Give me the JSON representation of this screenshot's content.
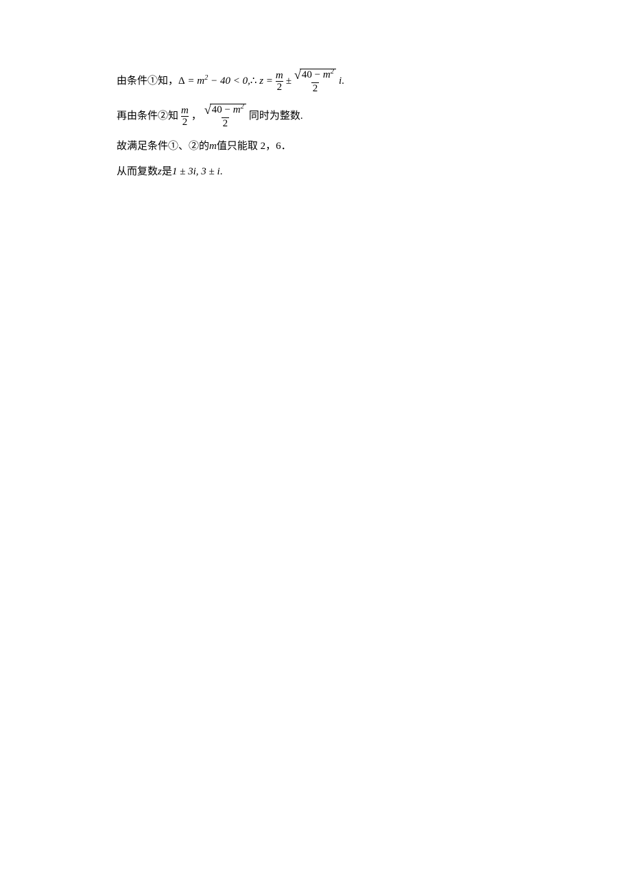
{
  "line1": {
    "t1": "由条件①知，",
    "delta": "Δ",
    "eq1_a": " = ",
    "m": "m",
    "sq": "2",
    "minus40": " − 40 < 0,",
    "therefore": "∴ ",
    "z": "z",
    "eq2": " = ",
    "frac1_num": "m",
    "frac1_den": "2",
    "pm": " ± ",
    "sqrt_inner_a": "40 − ",
    "sqrt_inner_m": "m",
    "sqrt_inner_sq": "2",
    "frac2_den": "2",
    "i": " i",
    "period": " ."
  },
  "line2": {
    "t1": "再由条件②知",
    "frac1_num": "m",
    "frac1_den": "2",
    "comma": " ，",
    "sqrt_inner_a": "40 − ",
    "sqrt_inner_m": "m",
    "sqrt_inner_sq": "2",
    "frac2_den": "2",
    "t2": " 同时为整数."
  },
  "line3": {
    "t1": "故满足条件①、②的",
    "m": "m",
    "t2": " 值只能取 2，6．"
  },
  "line4": {
    "t1": "从而复数",
    "z": "z",
    "t2": " 是",
    "expr": "1 ± 3i, 3 ± i",
    "period": " ."
  }
}
